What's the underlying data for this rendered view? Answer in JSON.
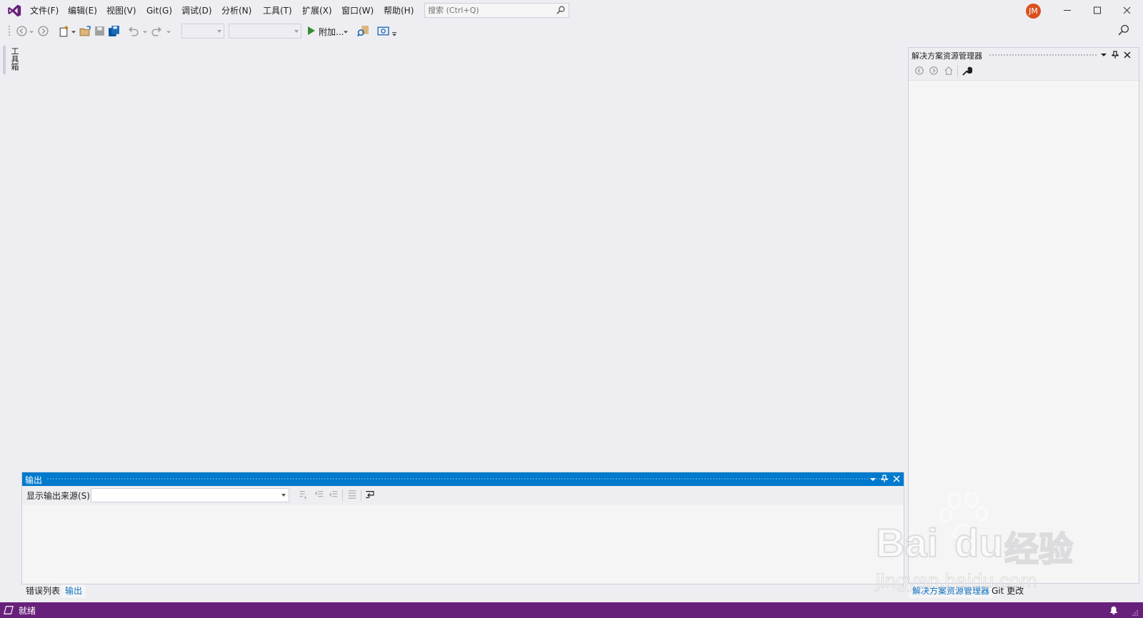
{
  "menu": {
    "items": [
      "文件(F)",
      "编辑(E)",
      "视图(V)",
      "Git(G)",
      "调试(D)",
      "分析(N)",
      "工具(T)",
      "扩展(X)",
      "窗口(W)",
      "帮助(H)"
    ]
  },
  "search": {
    "placeholder": "搜索 (Ctrl+Q)"
  },
  "account": {
    "initials": "JM"
  },
  "toolbar": {
    "attach_label": "附加..."
  },
  "toolbox": {
    "label": "工具箱"
  },
  "solution_explorer": {
    "title": "解决方案资源管理器"
  },
  "output": {
    "title": "输出",
    "source_label": "显示输出来源(S):",
    "source_value": ""
  },
  "bottom_tabs_left": [
    "错误列表",
    "输出"
  ],
  "bottom_tabs_right": [
    "解决方案资源管理器",
    "Git 更改"
  ],
  "status": {
    "text": "就绪"
  },
  "watermark": {
    "brand": "Bai",
    "brand2": "du",
    "cn": "经验",
    "url": "jingyan.baidu.com"
  },
  "colors": {
    "accent": "#007acc",
    "status_bar": "#68217a",
    "logo": "#68217a",
    "avatar": "#d9501e"
  }
}
